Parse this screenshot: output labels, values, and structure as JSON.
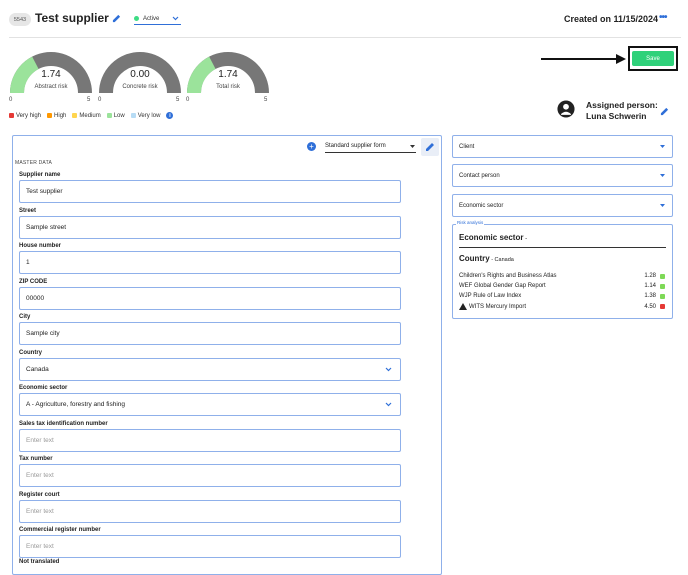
{
  "header": {
    "id_badge": "5543",
    "title": "Test supplier",
    "status": "Active",
    "created": "Created on 11/15/2024",
    "more": "•••"
  },
  "gauges": [
    {
      "value": "1.74",
      "label": "Abstract risk",
      "min": "0",
      "max": "5",
      "fraction": 0.348
    },
    {
      "value": "0.00",
      "label": "Concrete risk",
      "min": "0",
      "max": "5",
      "fraction": 0.0
    },
    {
      "value": "1.74",
      "label": "Total risk",
      "min": "0",
      "max": "5",
      "fraction": 0.348
    }
  ],
  "legend": [
    {
      "label": "Very high",
      "color": "#e53935"
    },
    {
      "label": "High",
      "color": "#ff9800"
    },
    {
      "label": "Medium",
      "color": "#ffd54f"
    },
    {
      "label": "Low",
      "color": "#9be39b"
    },
    {
      "label": "Very low",
      "color": "#b7dcf5"
    }
  ],
  "save_label": "Save",
  "assigned": {
    "label": "Assigned person:",
    "name": "Luna Schwerin"
  },
  "form": {
    "template": "Standard supplier form",
    "section": "MASTER DATA",
    "fields": [
      {
        "label": "Supplier name",
        "value": "Test supplier",
        "placeholder": false
      },
      {
        "label": "Street",
        "value": "Sample street",
        "placeholder": false
      },
      {
        "label": "House number",
        "value": "1",
        "placeholder": false
      },
      {
        "label": "ZIP CODE",
        "value": "00000",
        "placeholder": false
      },
      {
        "label": "City",
        "value": "Sample city",
        "placeholder": false
      },
      {
        "label": "Country",
        "value": "Canada",
        "placeholder": false,
        "select": true
      },
      {
        "label": "Economic sector",
        "value": "A - Agriculture, forestry and fishing",
        "placeholder": false,
        "select": true
      },
      {
        "label": "Sales tax identification number",
        "value": "Enter text",
        "placeholder": true
      },
      {
        "label": "Tax number",
        "value": "Enter text",
        "placeholder": true
      },
      {
        "label": "Register court",
        "value": "Enter text",
        "placeholder": true
      },
      {
        "label": "Commercial register number",
        "value": "Enter text",
        "placeholder": true
      }
    ],
    "cut_label": "Not translated"
  },
  "right": {
    "selects": [
      "Client",
      "Contact person",
      "Economic sector"
    ],
    "risk_analysis": {
      "legend": "Risk analysis",
      "econ_title": "Economic sector",
      "econ_dash": " -",
      "country_title": "Country",
      "country_value": " - Canada",
      "rows": [
        {
          "name": "Children's Rights and Business Atlas",
          "value": "1.28",
          "color": "#7ed957",
          "warn": false
        },
        {
          "name": "WEF Global Gender Gap Report",
          "value": "1.14",
          "color": "#7ed957",
          "warn": false
        },
        {
          "name": "WJP Rule of Law Index",
          "value": "1.38",
          "color": "#7ed957",
          "warn": false
        },
        {
          "name": "WITS Mercury Import",
          "value": "4.50",
          "color": "#e53935",
          "warn": true
        }
      ]
    }
  }
}
